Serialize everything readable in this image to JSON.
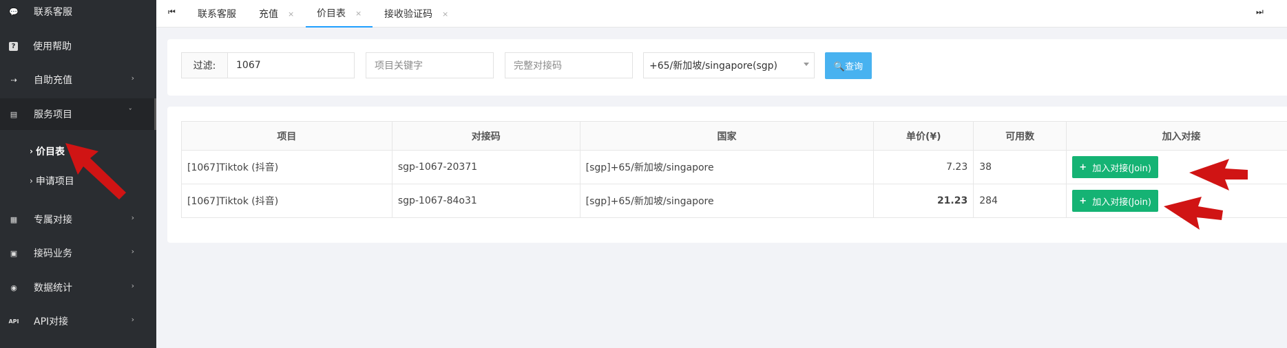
{
  "sidebar": {
    "items": [
      {
        "icon": "chat-bubble-icon",
        "glyph": "💬",
        "label": "联系客服",
        "has_chevron": false
      },
      {
        "icon": "help-icon",
        "glyph": "?",
        "label": "使用帮助",
        "has_chevron": false
      },
      {
        "icon": "bank-transfer-icon",
        "glyph": "⇢",
        "label": "自助充值",
        "has_chevron": true
      },
      {
        "icon": "card-icon",
        "glyph": "▤",
        "label": "服务项目",
        "has_chevron": true,
        "expanded": true
      },
      {
        "icon": "clipboard-icon",
        "glyph": "▦",
        "label": "专属对接",
        "has_chevron": true
      },
      {
        "icon": "dial-icon",
        "glyph": "▣",
        "label": "接码业务",
        "has_chevron": true
      },
      {
        "icon": "coins-icon",
        "glyph": "◉",
        "label": "数据统计",
        "has_chevron": true
      },
      {
        "icon": "api-icon",
        "glyph": "API",
        "label": "API对接",
        "has_chevron": true
      }
    ],
    "sub_items": [
      {
        "label": "价目表",
        "current": true
      },
      {
        "label": "申请项目",
        "current": false
      }
    ]
  },
  "tabs": [
    {
      "label": "联系客服",
      "closable": false
    },
    {
      "label": "充值",
      "closable": true
    },
    {
      "label": "价目表",
      "closable": true,
      "active": true
    },
    {
      "label": "接收验证码",
      "closable": true
    }
  ],
  "tab_nav": {
    "prev": "⏮",
    "next": "⏭"
  },
  "filter": {
    "label": "过滤:",
    "value": "1067",
    "keyword_placeholder": "项目关键字",
    "code_placeholder": "完整对接码",
    "country_selected": "+65/新加坡/singapore(sgp)",
    "query_label": "🔍查询"
  },
  "table": {
    "headers": [
      "项目",
      "对接码",
      "国家",
      "单价(¥)",
      "可用数",
      "加入对接"
    ],
    "rows": [
      {
        "project": "[1067]Tiktok (抖音)",
        "code": "sgp-1067-20371",
        "country": "[sgp]+65/新加坡/singapore",
        "price": "7.23",
        "available": "38",
        "join": "加入对接(Join)",
        "price_style": "normal"
      },
      {
        "project": "[1067]Tiktok (抖音)",
        "code": "sgp-1067-84o31",
        "country": "[sgp]+65/新加坡/singapore",
        "price": "21.23",
        "available": "284",
        "join": "加入对接(Join)",
        "price_style": "high"
      }
    ]
  },
  "colors": {
    "sidebar_bg": "#2a2d31",
    "accent_blue": "#48b2f0",
    "join_green": "#15b374",
    "price_green": "#2f9d3b",
    "price_red": "#e0201f",
    "annotation_arrow": "#d01414"
  }
}
